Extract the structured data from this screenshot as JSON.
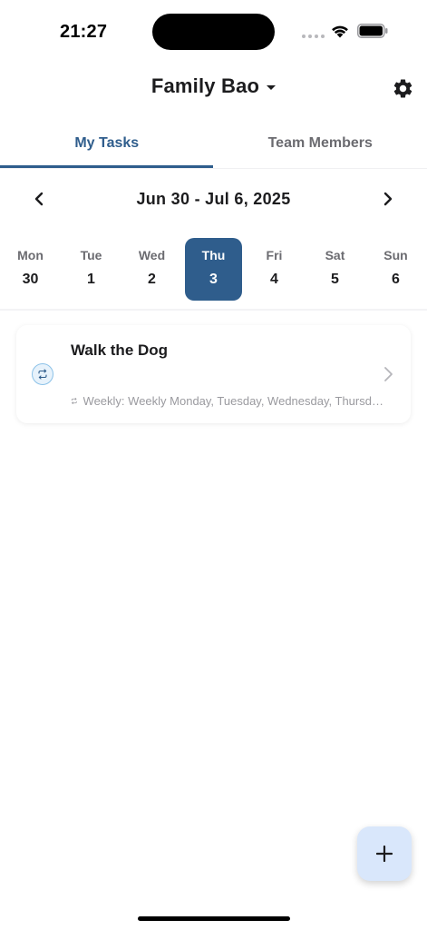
{
  "status_bar": {
    "time": "21:27"
  },
  "header": {
    "title": "Family Bao",
    "icons": [
      "caret-down-icon",
      "gear-icon"
    ]
  },
  "tabs": [
    {
      "label": "My Tasks",
      "active": true
    },
    {
      "label": "Team Members",
      "active": false
    }
  ],
  "week": {
    "range": "Jun 30 - Jul 6, 2025",
    "days": [
      {
        "dow": "Mon",
        "num": "30",
        "selected": false
      },
      {
        "dow": "Tue",
        "num": "1",
        "selected": false
      },
      {
        "dow": "Wed",
        "num": "2",
        "selected": false
      },
      {
        "dow": "Thu",
        "num": "3",
        "selected": true
      },
      {
        "dow": "Fri",
        "num": "4",
        "selected": false
      },
      {
        "dow": "Sat",
        "num": "5",
        "selected": false
      },
      {
        "dow": "Sun",
        "num": "6",
        "selected": false
      }
    ]
  },
  "tasks": [
    {
      "title": "Walk the Dog",
      "recurrence": "Weekly: Weekly Monday, Tuesday, Wednesday, Thursday, Friday, Saturday, Sunday",
      "icon": "repeat-icon"
    }
  ],
  "colors": {
    "accent": "#2f5d8c",
    "fab_background": "#d9e7fb"
  }
}
